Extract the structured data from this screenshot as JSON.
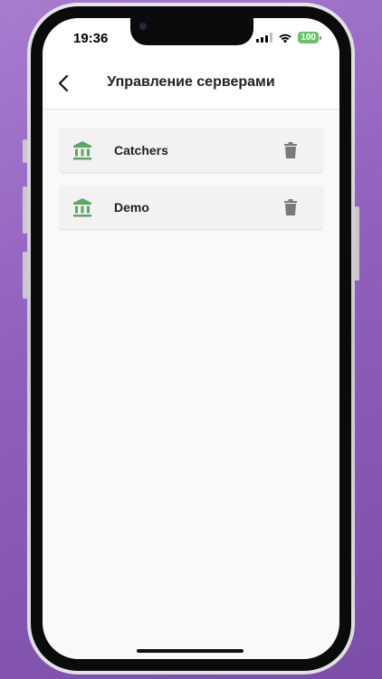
{
  "status_bar": {
    "time": "19:36",
    "battery": "100",
    "icons": [
      "signal-icon",
      "wifi-icon",
      "battery-icon"
    ]
  },
  "header": {
    "title": "Управление серверами",
    "back_icon": "chevron-left-icon"
  },
  "servers": [
    {
      "name": "Catchers",
      "icon": "bank-icon",
      "action_icon": "trash-icon"
    },
    {
      "name": "Demo",
      "icon": "bank-icon",
      "action_icon": "trash-icon"
    }
  ],
  "colors": {
    "accent_icon": "#5ea566",
    "delete_icon": "#7a7a7a",
    "battery": "#65c466",
    "background": "#f9f9f9"
  }
}
